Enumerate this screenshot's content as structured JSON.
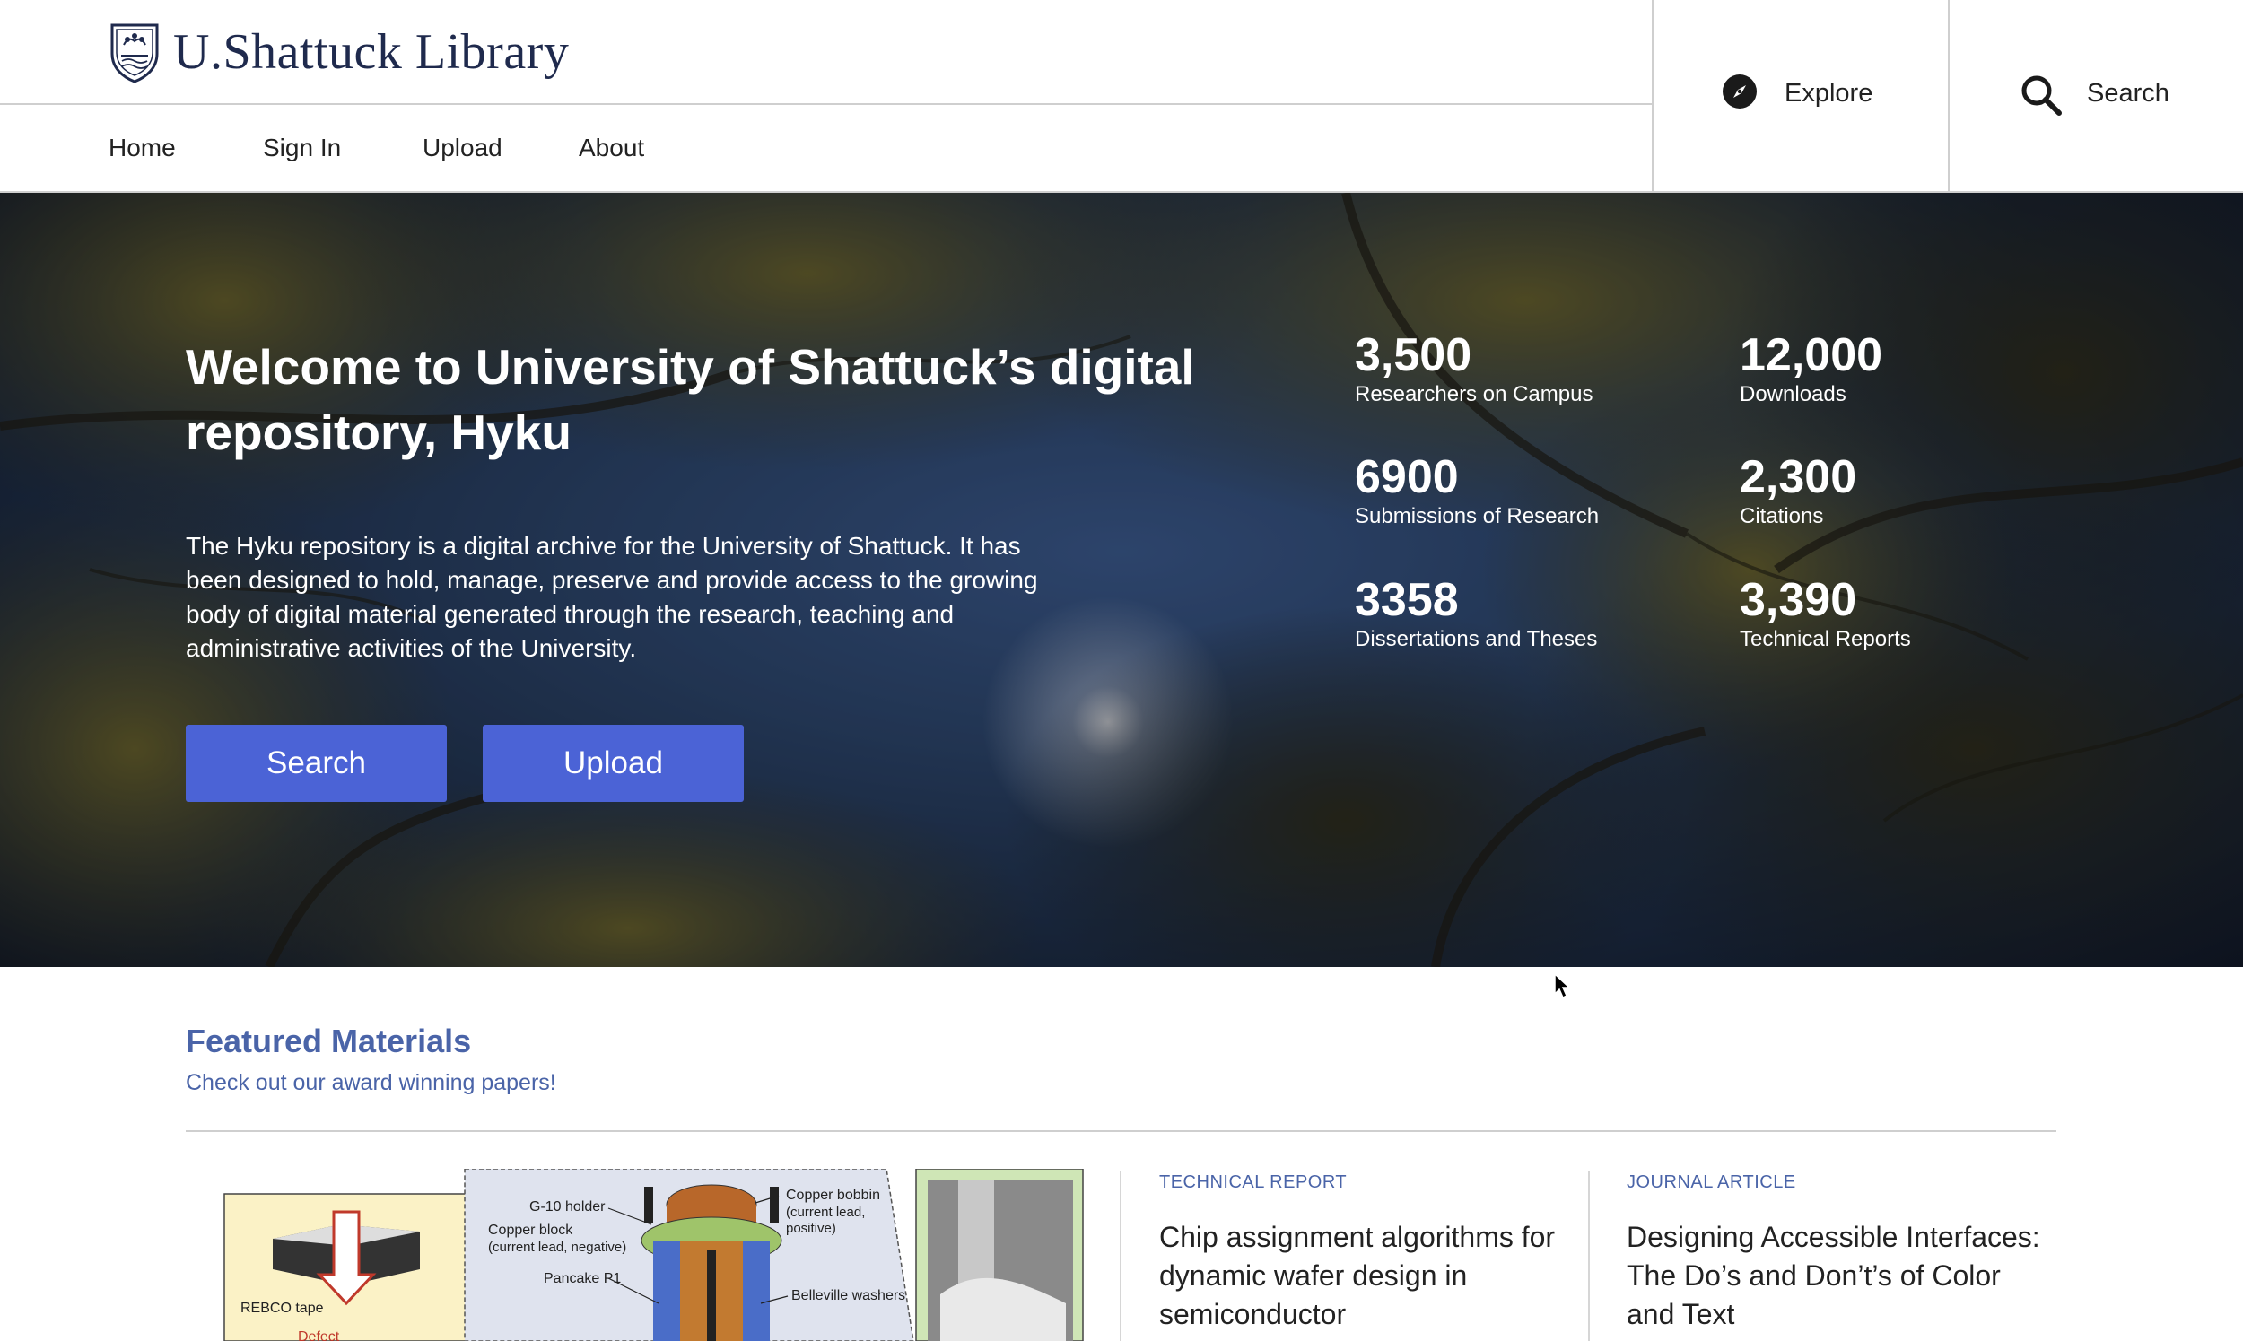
{
  "brand": {
    "name": "U.Shattuck Library"
  },
  "nav": {
    "items": [
      {
        "label": "Home"
      },
      {
        "label": "Sign In"
      },
      {
        "label": "Upload"
      },
      {
        "label": "About"
      }
    ],
    "explore_label": "Explore",
    "search_label": "Search"
  },
  "hero": {
    "title": "Welcome to University of Shattuck’s digital repository, Hyku",
    "description": "The Hyku repository is a digital archive for the University of Shattuck. It has been designed to hold, manage, preserve and provide access to the growing body of digital material generated through the research, teaching and administrative activities of the University.",
    "search_button": "Search",
    "upload_button": "Upload",
    "stats": [
      {
        "value": "3,500",
        "label": "Researchers on Campus"
      },
      {
        "value": "12,000",
        "label": "Downloads"
      },
      {
        "value": "6900",
        "label": "Submissions of Research"
      },
      {
        "value": "2,300",
        "label": "Citations"
      },
      {
        "value": "3358",
        "label": "Dissertations and Theses"
      },
      {
        "value": "3,390",
        "label": "Technical Reports"
      }
    ]
  },
  "featured": {
    "title": "Featured Materials",
    "subtitle": "Check out our award winning papers!",
    "figure_labels": {
      "g10": "G-10 holder",
      "copper_block": "Copper block",
      "copper_block_note": "(current lead, negative)",
      "copper_bobbin": "Copper bobbin",
      "copper_bobbin_note1": "(current lead,",
      "copper_bobbin_note2": "positive)",
      "pancake": "Pancake P1",
      "belleville": "Belleville washers",
      "rebco": "REBCO tape",
      "defect": "Defect"
    },
    "cards": [
      {
        "type": "TECHNICAL REPORT",
        "title": "Chip assignment algorithms for dynamic wafer design in semiconductor"
      },
      {
        "type": "JOURNAL ARTICLE",
        "title": "Designing Accessible Interfaces: The Do’s and Don’t’s of Color and Text"
      }
    ]
  },
  "colors": {
    "brand_navy": "#1f2a4d",
    "accent_blue": "#4b63d6",
    "link_blue": "#4a64a8"
  }
}
